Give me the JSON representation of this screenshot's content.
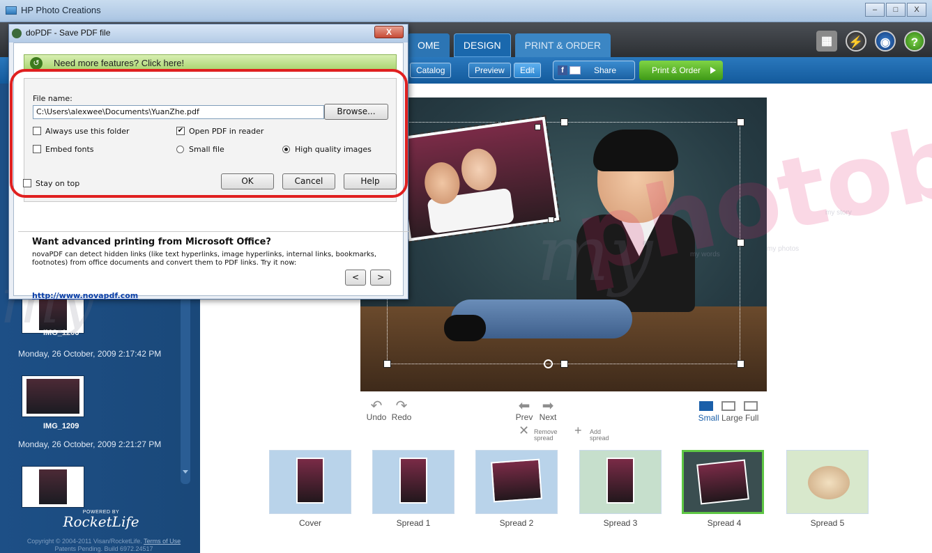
{
  "window": {
    "title": "HP Photo Creations",
    "controls": [
      "–",
      "□",
      "X"
    ]
  },
  "nav": {
    "tabs": [
      {
        "label": "OME"
      },
      {
        "label": "DESIGN"
      },
      {
        "label": "PRINT & ORDER"
      }
    ],
    "icons": [
      "cart-icon",
      "bolt-icon",
      "globe-icon",
      "help-icon"
    ],
    "help_glyph": "?"
  },
  "toolbar": {
    "catalog": "Catalog",
    "preview": "Preview",
    "edit": "Edit",
    "share": "Share",
    "share_fb": "f",
    "print_order": "Print & Order"
  },
  "sidebar": {
    "items": [
      {
        "name": "IMG_1206",
        "date": "Monday, 26 October, 2009 2:17:42 PM"
      },
      {
        "name": "IMG_1209",
        "date": "Monday, 26 October, 2009 2:21:27 PM"
      }
    ],
    "powered_by": "POWERED BY",
    "brand": "RocketLife",
    "copyright_prefix": "Copyright © 2004-2011 Visan/RocketLife.",
    "terms": "Terms of Use",
    "patents": "Patents Pending. Build 6972.24517"
  },
  "controls": {
    "undo": "Undo",
    "redo": "Redo",
    "prev": "Prev",
    "next": "Next",
    "remove_spread": "Remove spread",
    "remove_l1": "Remove",
    "remove_l2": "spread",
    "add_l1": "Add",
    "add_l2": "spread",
    "sizes": [
      "Small",
      "Large",
      "Full"
    ],
    "selected_size": "Small"
  },
  "spreads": [
    {
      "label": "Cover",
      "selected": false
    },
    {
      "label": "Spread 1",
      "selected": false
    },
    {
      "label": "Spread 2",
      "selected": false
    },
    {
      "label": "Spread 3",
      "selected": false
    },
    {
      "label": "Spread 4",
      "selected": true
    },
    {
      "label": "Spread 5",
      "selected": false
    }
  ],
  "watermark": {
    "brand": "photobook",
    "script": "my",
    "tag1": "my words",
    "tag2": "my story",
    "tag3": "my photos"
  },
  "dialog": {
    "title": "doPDF - Save PDF file",
    "close": "X",
    "promo": "Need more features? Click here!",
    "file_name_label": "File name:",
    "file_name_value": "C:\\Users\\alexwee\\Documents\\YuanZhe.pdf",
    "browse": "Browse...",
    "always_use_folder": {
      "label": "Always use this folder",
      "checked": false
    },
    "open_pdf": {
      "label": "Open PDF in reader",
      "checked": true
    },
    "embed_fonts": {
      "label": "Embed fonts",
      "checked": false
    },
    "small_file": {
      "label": "Small file",
      "selected": false
    },
    "high_quality": {
      "label": "High quality images",
      "selected": true
    },
    "stay_on_top": {
      "label": "Stay on top",
      "checked": false
    },
    "ok": "OK",
    "cancel": "Cancel",
    "help": "Help",
    "adv_heading": "Want advanced printing from Microsoft Office?",
    "adv_text": "novaPDF can detect hidden links (like text hyperlinks, image hyperlinks, internal links, bookmarks, footnotes) from office documents and convert them to PDF links. Try it now:",
    "link": "http://www.novapdf.com",
    "prev": "<",
    "next": ">",
    "check_glyph": "✔"
  }
}
